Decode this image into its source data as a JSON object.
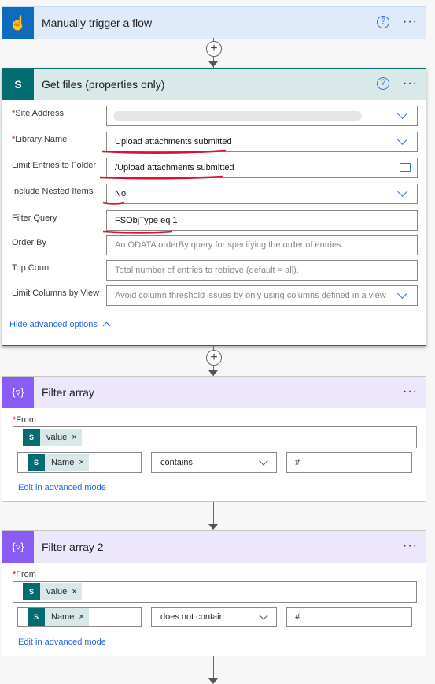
{
  "trigger": {
    "title": "Manually trigger a flow",
    "help": "?",
    "more": "···"
  },
  "get_files": {
    "title": "Get files (properties only)",
    "help": "?",
    "more": "···",
    "fields": [
      {
        "label": "Site Address",
        "required": true,
        "value": ""
      },
      {
        "label": "Library Name",
        "required": true,
        "value": "Upload attachments submitted"
      },
      {
        "label": "Limit Entries to Folder",
        "required": false,
        "value": "/Upload attachments submitted"
      },
      {
        "label": "Include Nested Items",
        "required": false,
        "value": "No"
      },
      {
        "label": "Filter Query",
        "required": false,
        "value": "FSObjType eq 1"
      },
      {
        "label": "Order By",
        "required": false,
        "placeholder": "An ODATA orderBy query for specifying the order of entries."
      },
      {
        "label": "Top Count",
        "required": false,
        "placeholder": "Total number of entries to retrieve (default = all)."
      },
      {
        "label": "Limit Columns by View",
        "required": false,
        "placeholder": "Avoid column threshold issues by only using columns defined in a view"
      }
    ],
    "hide_advanced": "Hide advanced options"
  },
  "filters": [
    {
      "title": "Filter array",
      "more": "···",
      "from_label": "From",
      "from_token": "value",
      "left_token": "Name",
      "operator": "contains",
      "right_value": "#",
      "advanced_link": "Edit in advanced mode"
    },
    {
      "title": "Filter array 2",
      "more": "···",
      "from_label": "From",
      "from_token": "value",
      "left_token": "Name",
      "operator": "does not contain",
      "right_value": "#",
      "advanced_link": "Edit in advanced mode"
    }
  ],
  "connector": {
    "plus": "+",
    "remove": "×",
    "required_mark": "*",
    "sp_icon": "S"
  },
  "colors": {
    "trigger": "#0f6cbd",
    "sharepoint": "#036c70",
    "filter": "#8a5bf5",
    "annotation": "#e0102a"
  }
}
